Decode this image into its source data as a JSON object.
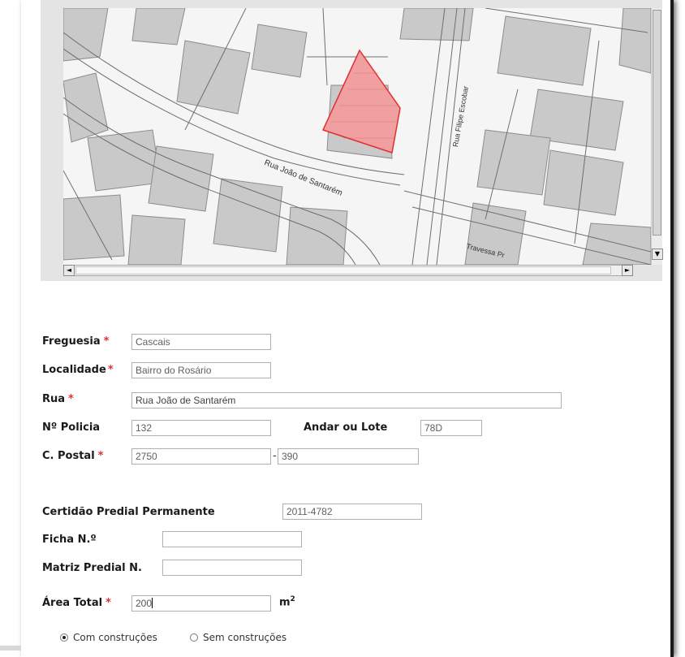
{
  "map": {
    "street_labels": [
      "Rua João de Santarém",
      "Rua Filipe Escobar",
      "Travessa Pr"
    ],
    "parcel_color": "#e03030",
    "scroll_left_label": "◄",
    "scroll_right_label": "►",
    "scroll_up_label": "▲",
    "scroll_down_label": "▼"
  },
  "form": {
    "freguesia": {
      "label": "Freguesia",
      "required": "*",
      "value": "Cascais"
    },
    "localidade": {
      "label": "Localidade",
      "required": "*",
      "value": "Bairro do Rosário"
    },
    "rua": {
      "label": "Rua",
      "required": "*",
      "value": "Rua João de Santarém"
    },
    "n_policia": {
      "label": "Nº Policia",
      "value": "132"
    },
    "andar_lote": {
      "label": "Andar ou Lote",
      "value": "78D"
    },
    "codigo_postal": {
      "label": "C. Postal",
      "required": "*",
      "value_main": "2750",
      "separator": "-",
      "value_suffix": "390"
    },
    "certidao": {
      "label": "Certidão Predial Permanente",
      "value": "2011-4782"
    },
    "ficha": {
      "label": "Ficha N.º",
      "value": ""
    },
    "matriz": {
      "label": "Matriz Predial N.",
      "value": ""
    },
    "area_total": {
      "label": "Área Total",
      "required": "*",
      "value": "200",
      "unit": "m",
      "unit_exp": "2"
    },
    "construcoes": {
      "options": [
        {
          "label": "Com construções",
          "selected": true
        },
        {
          "label": "Sem construções",
          "selected": false
        }
      ]
    }
  }
}
